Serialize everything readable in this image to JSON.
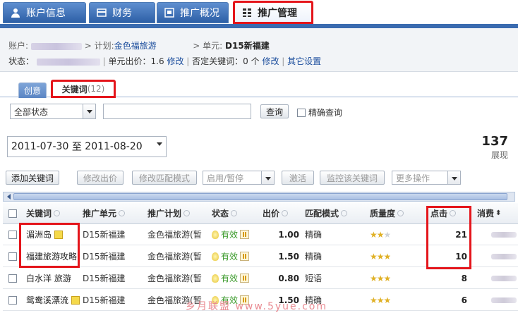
{
  "top_tabs": [
    {
      "label": "账户信息",
      "icon": "user-icon"
    },
    {
      "label": "财务",
      "icon": "card-icon"
    },
    {
      "label": "推广概况",
      "icon": "overview-icon"
    },
    {
      "label": "推广管理",
      "icon": "grid-icon",
      "active": true
    }
  ],
  "breadcrumb": {
    "account_label": "账户:",
    "plan_sep": "> 计划:",
    "plan_name": "金色福旅游",
    "unit_sep": "> 单元:",
    "unit_name": "D15新福建"
  },
  "status_line": {
    "status_label": "状态：",
    "unit_bid_label": "单元出价：1.6",
    "modify1": "修改",
    "neg_kw_label": "否定关键词：0 个",
    "modify2": "修改",
    "other_settings": "其它设置"
  },
  "sub_tabs": [
    {
      "label": "创意"
    },
    {
      "label": "关键词",
      "count": "(12)",
      "active": true
    }
  ],
  "filter": {
    "status_select": "全部状态",
    "search_value": "",
    "query_button": "查询",
    "exact_checkbox_label": "精确查询",
    "exact_checked": false
  },
  "date_range": {
    "start": "2011-07-30",
    "sep": "至",
    "end": "2011-08-20"
  },
  "summary": {
    "value": "137",
    "label": "展现"
  },
  "toolbar": {
    "add_keyword": "添加关键词",
    "modify_bid": "修改出价",
    "modify_match": "修改匹配模式",
    "enable_pause": "启用/暂停",
    "activate": "激活",
    "monitor": "监控该关键词",
    "more": "更多操作"
  },
  "table": {
    "headers": [
      "关键词",
      "推广单元",
      "推广计划",
      "状态",
      "出价",
      "匹配模式",
      "质量度",
      "点击",
      "消费"
    ],
    "rows": [
      {
        "keyword": "湄洲岛",
        "unit": "D15新福建",
        "plan": "金色福旅游",
        "plan_tail": "(暂",
        "status": "有效",
        "bid": "1.00",
        "match": "精确",
        "stars": 2,
        "clicks": "21",
        "note": true
      },
      {
        "keyword": "福建旅游攻略",
        "unit": "D15新福建",
        "plan": "金色福旅游",
        "plan_tail": "(暂",
        "status": "有效",
        "bid": "1.50",
        "match": "精确",
        "stars": 3,
        "clicks": "10",
        "note": false
      },
      {
        "keyword": "白水洋 旅游",
        "unit": "D15新福建",
        "plan": "金色福旅游",
        "plan_tail": "(暂",
        "status": "有效",
        "bid": "0.80",
        "match": "短语",
        "stars": 3,
        "clicks": "8",
        "note": false
      },
      {
        "keyword": "鸳鸯溪漂流",
        "unit": "D15新福建",
        "plan": "金色福旅游",
        "plan_tail": "(暂",
        "status": "有效",
        "bid": "1.50",
        "match": "精确",
        "stars": 3,
        "clicks": "6",
        "note": true
      }
    ]
  },
  "watermark": "乡月联盟 www.5yue.com",
  "colors": {
    "accent_red": "#e4151b",
    "tab_blue": "#3a6bb0",
    "link_blue": "#1a4c9c",
    "valid_green": "#3a9a2a"
  }
}
